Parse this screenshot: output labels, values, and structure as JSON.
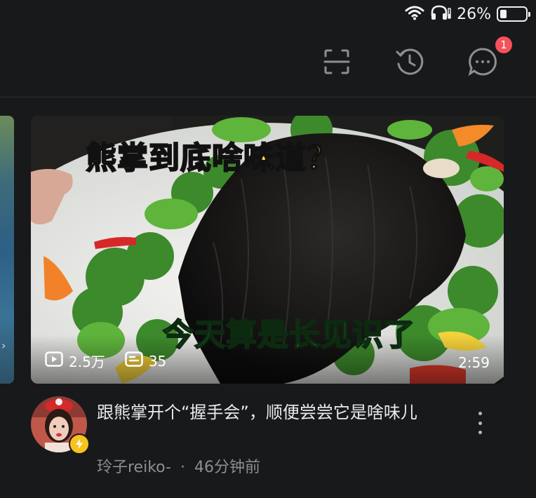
{
  "status_bar": {
    "battery_percent_label": "26%",
    "battery_level": 0.26,
    "icons": [
      "wifi-icon",
      "headphones-icon",
      "battery-icon"
    ]
  },
  "top_bar": {
    "icons": [
      "scan-icon",
      "history-icon",
      "message-icon"
    ],
    "message_badge": "1",
    "badge_color": "#f4525a"
  },
  "video": {
    "overlay_title": "熊掌到底啥味道？",
    "overlay_subtitle": "今天算是长见识了",
    "views": "2.5万",
    "comments": "35",
    "duration": "2:59",
    "title": "跟熊掌开个“握手会”，顺便尝尝它是啥味儿",
    "author": "玲子reiko-",
    "separator": "·",
    "time_ago": "46分钟前"
  },
  "colors": {
    "background": "#18191b",
    "overlay_yellow": "#ffe14a",
    "overlay_green": "#3ee06a",
    "verified": "#f7c21d"
  }
}
